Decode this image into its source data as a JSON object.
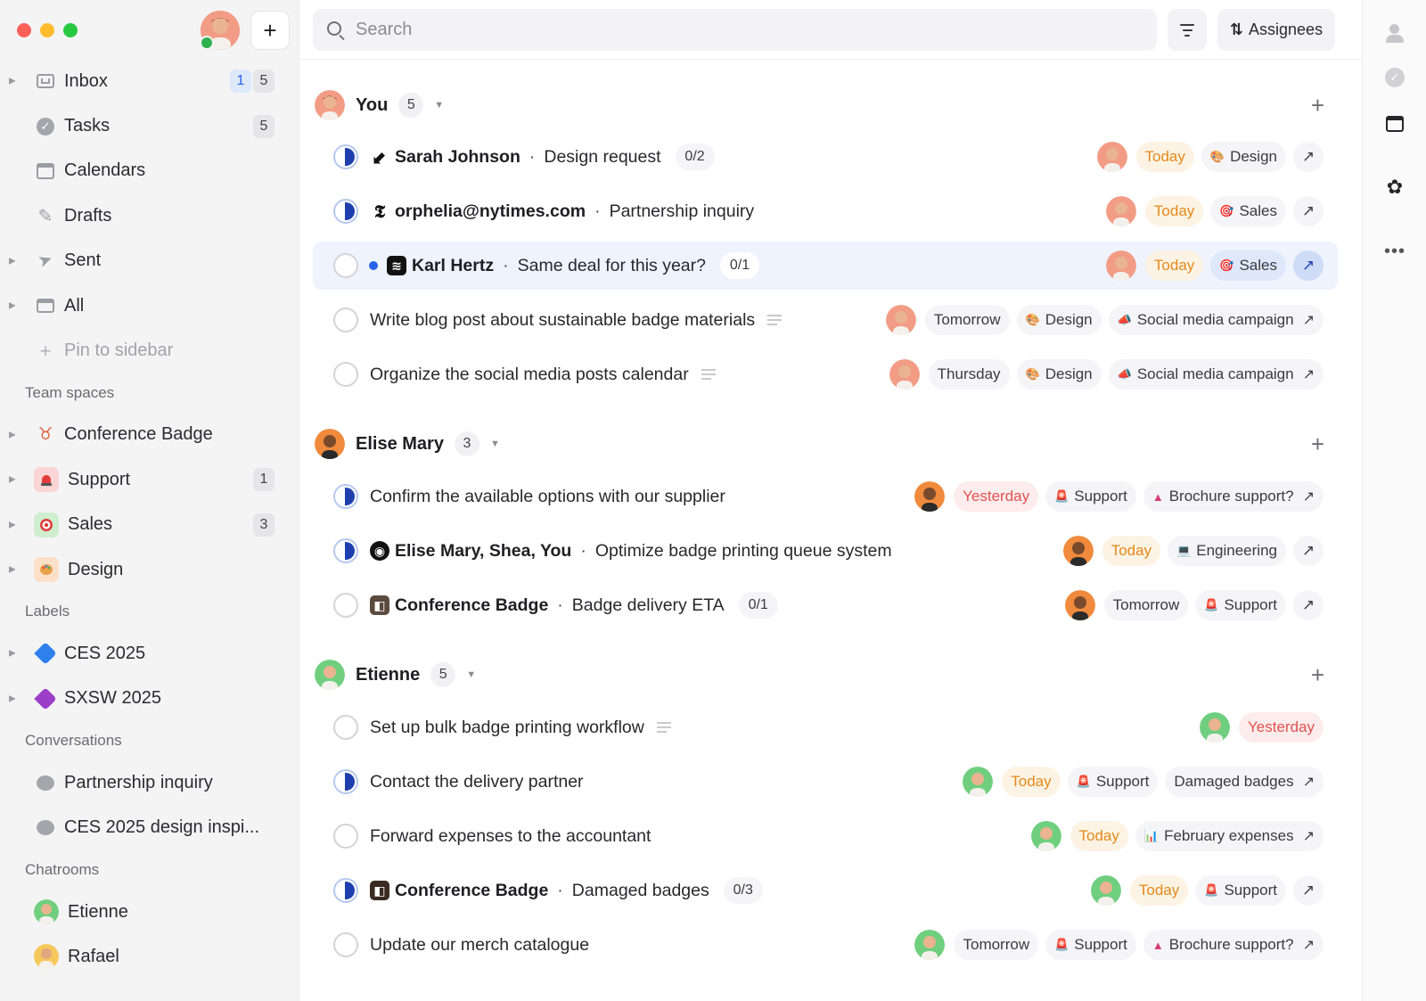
{
  "colors": {
    "accent_blue": "#2563eb",
    "today_orange": "#e38a1b",
    "yesterday_red": "#e05252",
    "sidebar_bg": "#f4f4f5"
  },
  "sidebar": {
    "new_button": "+",
    "nav": [
      {
        "label": "Inbox",
        "icon": "inbox-icon",
        "counts": [
          "1",
          "5"
        ]
      },
      {
        "label": "Tasks",
        "icon": "check-circle-icon",
        "counts": [
          "5"
        ]
      },
      {
        "label": "Calendars",
        "icon": "calendar-icon"
      },
      {
        "label": "Drafts",
        "icon": "pencil-icon"
      },
      {
        "label": "Sent",
        "icon": "send-icon"
      },
      {
        "label": "All",
        "icon": "archive-icon"
      },
      {
        "label": "Pin to sidebar",
        "icon": "plus-icon"
      }
    ],
    "team_spaces_title": "Team spaces",
    "team_spaces": [
      {
        "label": "Conference Badge",
        "icon": "badge-icon"
      },
      {
        "label": "Support",
        "icon": "siren-icon",
        "count": "1"
      },
      {
        "label": "Sales",
        "icon": "target-icon",
        "count": "3"
      },
      {
        "label": "Design",
        "icon": "palette-icon"
      }
    ],
    "labels_title": "Labels",
    "labels": [
      {
        "label": "CES 2025",
        "icon": "tag-icon",
        "color": "#2f80ed"
      },
      {
        "label": "SXSW 2025",
        "icon": "tag-icon",
        "color": "#9b3fc9"
      }
    ],
    "conversations_title": "Conversations",
    "conversations": [
      {
        "label": "Partnership inquiry",
        "icon": "chat-bubble-icon"
      },
      {
        "label": "CES 2025 design inspi...",
        "icon": "chat-bubble-icon"
      }
    ],
    "chatrooms_title": "Chatrooms",
    "chatrooms": [
      {
        "label": "Etienne",
        "icon": "avatar"
      },
      {
        "label": "Rafael",
        "icon": "avatar"
      }
    ]
  },
  "toolbar": {
    "search_placeholder": "Search",
    "assignees_label": "Assignees"
  },
  "groups": [
    {
      "name": "You",
      "count": "5",
      "rows": [
        {
          "sender": "Sarah Johnson",
          "subject": "Design request",
          "sub_count": "0/2",
          "date": "Today",
          "labels": [
            "Design"
          ]
        },
        {
          "sender": "orphelia@nytimes.com",
          "subject": "Partnership inquiry",
          "date": "Today",
          "labels": [
            "Sales"
          ]
        },
        {
          "sender": "Karl Hertz",
          "subject": "Same deal for this year?",
          "sub_count": "0/1",
          "date": "Today",
          "labels": [
            "Sales"
          ]
        },
        {
          "title": "Write blog post about sustainable badge materials",
          "date": "Tomorrow",
          "labels": [
            "Design",
            "Social media campaign"
          ]
        },
        {
          "title": "Organize the social media posts calendar",
          "date": "Thursday",
          "labels": [
            "Design",
            "Social media campaign"
          ]
        }
      ]
    },
    {
      "name": "Elise Mary",
      "count": "3",
      "rows": [
        {
          "title": "Confirm the available options with our supplier",
          "date": "Yesterday",
          "labels": [
            "Support",
            "Brochure support?"
          ]
        },
        {
          "sender": "Elise Mary, Shea, You",
          "subject": "Optimize badge printing queue system",
          "date": "Today",
          "labels": [
            "Engineering"
          ]
        },
        {
          "sender": "Conference Badge",
          "subject": "Badge delivery ETA",
          "sub_count": "0/1",
          "date": "Tomorrow",
          "labels": [
            "Support"
          ]
        }
      ]
    },
    {
      "name": "Etienne",
      "count": "5",
      "rows": [
        {
          "title": "Set up bulk badge printing workflow",
          "date": "Yesterday",
          "labels": []
        },
        {
          "title": "Contact the delivery partner",
          "date": "Today",
          "labels": [
            "Support",
            "Damaged badges"
          ]
        },
        {
          "title": "Forward expenses to the accountant",
          "date": "Today",
          "labels": [
            "February expenses"
          ]
        },
        {
          "sender": "Conference Badge",
          "subject": "Damaged badges",
          "sub_count": "0/3",
          "date": "Today",
          "labels": [
            "Support"
          ]
        },
        {
          "title": "Update our merch catalogue",
          "date": "Tomorrow",
          "labels": [
            "Support",
            "Brochure support?"
          ]
        }
      ]
    }
  ],
  "rail": {
    "more_label": "•••"
  }
}
